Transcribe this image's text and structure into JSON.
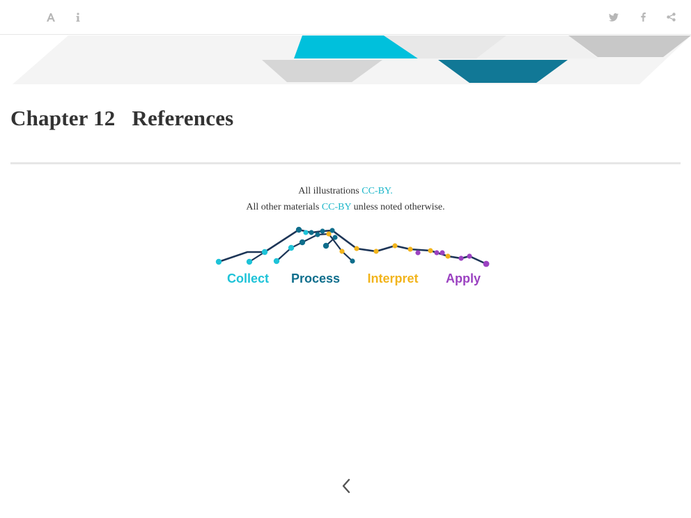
{
  "toolbar": {
    "left_icons": [
      "font-settings-icon",
      "info-icon"
    ],
    "right_icons": [
      "twitter-icon",
      "facebook-icon",
      "share-icon"
    ]
  },
  "chapter": {
    "number": "Chapter 12",
    "title": "References"
  },
  "footer": {
    "line1_prefix": "All illustrations ",
    "line1_link": "CC-BY.",
    "line2_prefix": "All other materials ",
    "line2_link": "CC-BY",
    "line2_suffix": " unless noted otherwise."
  },
  "logo": {
    "labels": [
      "Collect",
      "Process",
      "Interpret",
      "Apply"
    ],
    "colors": {
      "collect": "#1ec3d8",
      "process": "#0f6e8c",
      "interpret": "#f2b41c",
      "apply": "#9b42c1",
      "line": "#1d3557"
    }
  },
  "colors": {
    "link": "#1ab6c9",
    "icon_gray": "#b7b7b7"
  },
  "nav": {
    "prev_icon": "chevron-left-icon"
  }
}
